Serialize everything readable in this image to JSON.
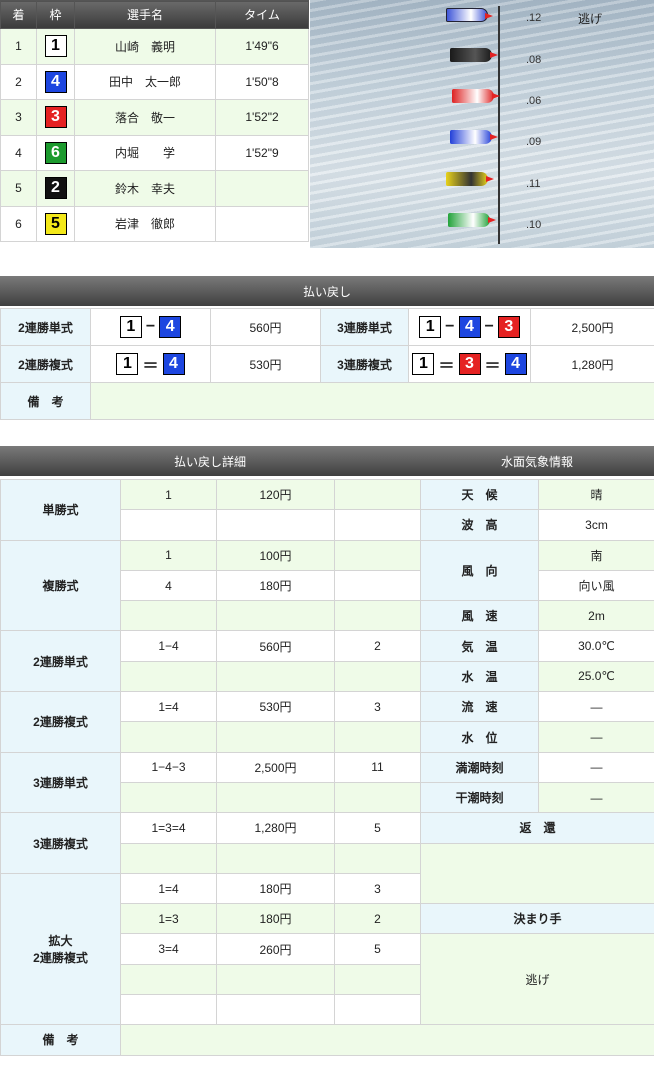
{
  "results": {
    "headers": [
      "着",
      "枠",
      "選手名",
      "タイム"
    ],
    "rows": [
      {
        "rank": "1",
        "waku": "1",
        "name": "山崎　義明",
        "time": "1'49\"6"
      },
      {
        "rank": "2",
        "waku": "4",
        "name": "田中　太一郎",
        "time": "1'50\"8"
      },
      {
        "rank": "3",
        "waku": "3",
        "name": "落合　敬一",
        "time": "1'52\"2"
      },
      {
        "rank": "4",
        "waku": "6",
        "name": "内堀　　学",
        "time": "1'52\"9"
      },
      {
        "rank": "5",
        "waku": "2",
        "name": "鈴木　幸夫",
        "time": ""
      },
      {
        "rank": "6",
        "waku": "5",
        "name": "岩津　徹郎",
        "time": ""
      }
    ]
  },
  "start": {
    "timings": [
      ".12",
      ".08",
      ".06",
      ".09",
      ".11",
      ".10"
    ],
    "kimarite": "逃げ"
  },
  "payout": {
    "header": "払い戻し",
    "r1_label_a": "2連勝単式",
    "r1_amount_a": "560円",
    "r1_label_b": "3連勝単式",
    "r1_amount_b": "2,500円",
    "r2_label_a": "2連勝複式",
    "r2_amount_a": "530円",
    "r2_label_b": "3連勝複式",
    "r2_amount_b": "1,280円",
    "remarks_label": "備　考"
  },
  "detail": {
    "header_left": "払い戻し詳細",
    "header_right": "水面気象情報",
    "tansho": "単勝式",
    "fukusho": "複勝式",
    "nirentan": "2連勝単式",
    "nirenpuku": "2連勝複式",
    "sanrentan": "3連勝単式",
    "sanrenpuku": "3連勝複式",
    "kakudai": "拡大\n2連勝複式",
    "remarks": "備　考",
    "rows": {
      "tansho": {
        "combo": "1",
        "amount": "120円"
      },
      "fuku1": {
        "combo": "1",
        "amount": "100円"
      },
      "fuku2": {
        "combo": "4",
        "amount": "180円"
      },
      "nitan": {
        "combo": "1−4",
        "amount": "560円",
        "pop": "2"
      },
      "nipuku": {
        "combo": "1=4",
        "amount": "530円",
        "pop": "3"
      },
      "santan": {
        "combo": "1−4−3",
        "amount": "2,500円",
        "pop": "11"
      },
      "sanpuku": {
        "combo": "1=3=4",
        "amount": "1,280円",
        "pop": "5"
      },
      "kak1": {
        "combo": "1=4",
        "amount": "180円",
        "pop": "3"
      },
      "kak2": {
        "combo": "1=3",
        "amount": "180円",
        "pop": "2"
      },
      "kak3": {
        "combo": "3=4",
        "amount": "260円",
        "pop": "5"
      }
    },
    "weather": {
      "tenko": "天　候",
      "tenko_v": "晴",
      "hakou": "波　高",
      "hakou_v": "3cm",
      "fukou": "風　向",
      "fukou_v1": "南",
      "fukou_v2": "向い風",
      "fusoku": "風　速",
      "fusoku_v": "2m",
      "kion": "気　温",
      "kion_v": "30.0℃",
      "suion": "水　温",
      "suion_v": "25.0℃",
      "ryusoku": "流　速",
      "ryusoku_v": "―",
      "suii": "水　位",
      "suii_v": "―",
      "mancho": "満潮時刻",
      "mancho_v": "―",
      "kancho": "干潮時刻",
      "kancho_v": "―",
      "henkan": "返　還",
      "kimarite_label": "決まり手",
      "kimarite_v": "逃げ"
    }
  },
  "colors": {
    "waku1": "#ffffff",
    "waku2": "#111111",
    "waku3": "#e52222",
    "waku4": "#1d46e0",
    "waku5": "#f3e81a",
    "waku6": "#1c9a2e",
    "label_bg": "#e9f6fb",
    "stripe_bg": "#effbe8"
  }
}
